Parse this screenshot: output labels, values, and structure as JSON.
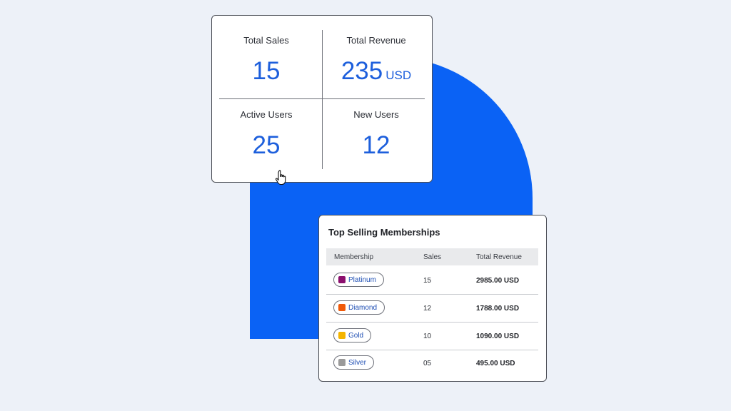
{
  "stats": {
    "total_sales": {
      "label": "Total Sales",
      "value": "15"
    },
    "total_revenue": {
      "label": "Total Revenue",
      "value": "235",
      "unit": "USD"
    },
    "active_users": {
      "label": "Active Users",
      "value": "25"
    },
    "new_users": {
      "label": "New Users",
      "value": "12"
    }
  },
  "table": {
    "title": "Top Selling Memberships",
    "headers": {
      "membership": "Membership",
      "sales": "Sales",
      "revenue": "Total Revenue"
    },
    "rows": [
      {
        "membership": "Platinum",
        "color": "#8b0f6e",
        "sales": "15",
        "revenue": "2985.00 USD"
      },
      {
        "membership": "Diamond",
        "color": "#f05a0a",
        "sales": "12",
        "revenue": "1788.00 USD"
      },
      {
        "membership": "Gold",
        "color": "#f4b400",
        "sales": "10",
        "revenue": "1090.00 USD"
      },
      {
        "membership": "Silver",
        "color": "#9a9a9a",
        "sales": "05",
        "revenue": "495.00 USD"
      }
    ]
  },
  "colors": {
    "accent": "#1d5fdc",
    "brand_blue": "#0a62f5",
    "background": "#edf1f8"
  },
  "icons": {
    "cursor": "hand-pointer-icon"
  }
}
